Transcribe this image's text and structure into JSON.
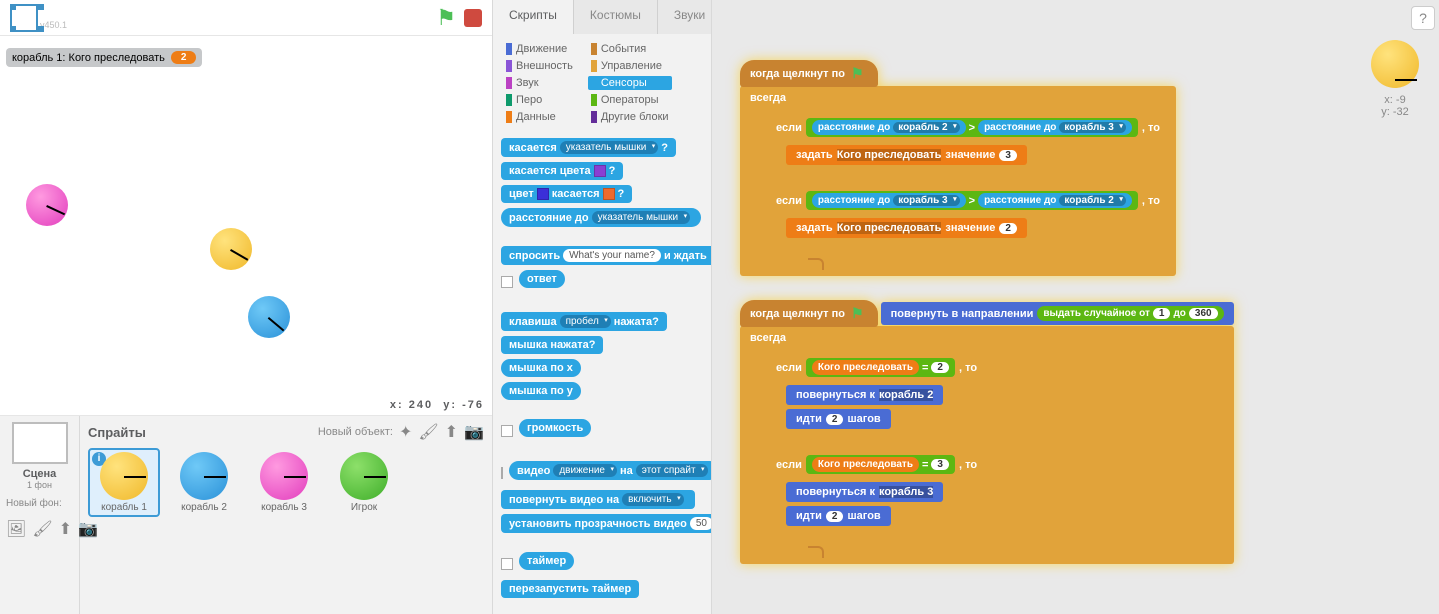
{
  "version": "v450.1",
  "stage": {
    "monitor_label": "корабль 1: Кого преследовать",
    "monitor_value": "2",
    "mouse_x_label": "x:",
    "mouse_x": "240",
    "mouse_y_label": "y:",
    "mouse_y": "-76"
  },
  "sceneCol": {
    "label": "Сцена",
    "sub": "1 фон",
    "newbg": "Новый фон:"
  },
  "spritesHead": {
    "title": "Спрайты",
    "newObject": "Новый объект:"
  },
  "sprites": [
    {
      "name": "корабль 1",
      "color": "yellow",
      "selected": true
    },
    {
      "name": "корабль 2",
      "color": "blue"
    },
    {
      "name": "корабль 3",
      "color": "pink"
    },
    {
      "name": "Игрок",
      "color": "green"
    }
  ],
  "tabs": {
    "scripts": "Скрипты",
    "costumes": "Костюмы",
    "sounds": "Звуки"
  },
  "categories": {
    "left": [
      {
        "name": "Движение",
        "color": "#4a6cd4"
      },
      {
        "name": "Внешность",
        "color": "#8a55d7"
      },
      {
        "name": "Звук",
        "color": "#bb42c3"
      },
      {
        "name": "Перо",
        "color": "#0e9a6c"
      },
      {
        "name": "Данные",
        "color": "#ee7d16"
      }
    ],
    "right": [
      {
        "name": "События",
        "color": "#c88330"
      },
      {
        "name": "Управление",
        "color": "#e1a33a"
      },
      {
        "name": "Сенсоры",
        "color": "#2ca5e2",
        "selected": true
      },
      {
        "name": "Операторы",
        "color": "#5cb712"
      },
      {
        "name": "Другие блоки",
        "color": "#632d99"
      }
    ]
  },
  "palette": {
    "touching": "касается",
    "touching_arg": "указатель мышки",
    "touchingColor": "касается цвета",
    "q": "?",
    "colorTouching": "цвет",
    "colorTouching2": "касается",
    "distanceTo": "расстояние до",
    "distanceTo_arg": "указатель мышки",
    "ask": "спросить",
    "ask_arg": "What's your name?",
    "ask_wait": "и ждать",
    "answer": "ответ",
    "keyPressed": "клавиша",
    "keyPressed_arg": "пробел",
    "keyPressed2": "нажата?",
    "mouseDown": "мышка нажата?",
    "mouseX": "мышка по x",
    "mouseY": "мышка по y",
    "loudness": "громкость",
    "video": "видео",
    "video_arg1": "движение",
    "video_on": "на",
    "video_arg2": "этот спрайт",
    "turnVideo": "повернуть видео на",
    "turnVideo_arg": "включить",
    "setTransparency": "установить прозрачность видео",
    "setTransparency_arg": "50",
    "timer": "таймер",
    "resetTimer": "перезапустить таймер"
  },
  "scripts": {
    "hat": "когда щелкнут по",
    "forever": "всегда",
    "if": "если",
    "then": ", то",
    "distanceTo": "расстояние до",
    "gt": ">",
    "setVar": "задать",
    "varName": "Кого преследовать",
    "toValue": "значение",
    "ship2": "корабль 2",
    "ship3": "корабль 3",
    "val3": "3",
    "val2": "2",
    "pointDir": "повернуть в направлении",
    "randomFrom": "выдать случайное от",
    "randomTo": "до",
    "r1": "1",
    "r360": "360",
    "eq": "=",
    "pointTowards": "повернуться к",
    "move": "идти",
    "moveSteps": "2",
    "steps": "шагов"
  },
  "thumbInfo": {
    "x_label": "x:",
    "x": "-9",
    "y_label": "y:",
    "y": "-32"
  }
}
